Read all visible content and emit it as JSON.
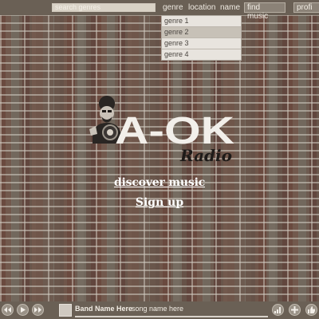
{
  "topbar": {
    "search": {
      "placeholder": "search genres",
      "value": ""
    },
    "nav": {
      "genre": "genre",
      "location": "location",
      "name": "name"
    },
    "find_music": "find music",
    "profile": "profi"
  },
  "dropdown": {
    "options": [
      "genre 1",
      "genre 2",
      "genre 3",
      "genre 4"
    ],
    "selected": "genre 2"
  },
  "logo": {
    "main": "A-OK",
    "script": "Radio"
  },
  "links": {
    "discover": "discover music",
    "signup": "Sign up"
  },
  "player": {
    "band": "Band Name Here",
    "song": "song name here",
    "progress": 0.0
  },
  "colors": {
    "bar": "#6a6055",
    "text": "#f3eee6",
    "selected_option": "#c7c1b7"
  }
}
